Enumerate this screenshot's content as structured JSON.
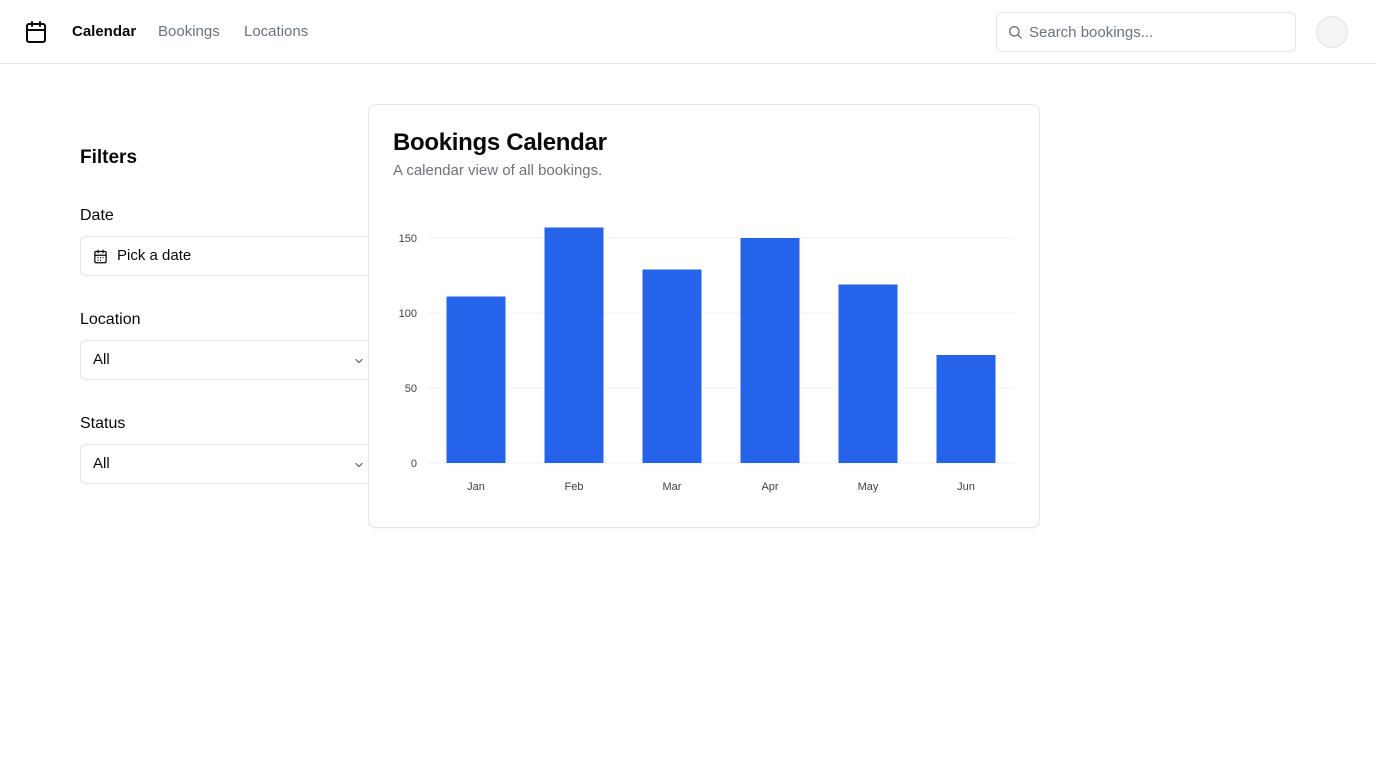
{
  "header": {
    "nav": [
      {
        "label": "Calendar",
        "active": true
      },
      {
        "label": "Bookings",
        "active": false
      },
      {
        "label": "Locations",
        "active": false
      }
    ],
    "search_placeholder": "Search bookings..."
  },
  "filters": {
    "title": "Filters",
    "date": {
      "label": "Date",
      "value": "Pick a date"
    },
    "location": {
      "label": "Location",
      "value": "All"
    },
    "status": {
      "label": "Status",
      "value": "All"
    }
  },
  "card": {
    "title": "Bookings Calendar",
    "subtitle": "A calendar view of all bookings."
  },
  "colors": {
    "accent": "#2563eb",
    "grid": "#f1f1f3",
    "tick_text": "#3f3f46"
  },
  "chart_data": {
    "type": "bar",
    "title": "",
    "xlabel": "",
    "ylabel": "",
    "categories": [
      "Jan",
      "Feb",
      "Mar",
      "Apr",
      "May",
      "Jun"
    ],
    "values": [
      111,
      157,
      129,
      150,
      119,
      72
    ],
    "ylim": [
      0,
      150
    ],
    "yticks": [
      0,
      50,
      100,
      150
    ],
    "grid": "horizontal",
    "legend": "none"
  }
}
